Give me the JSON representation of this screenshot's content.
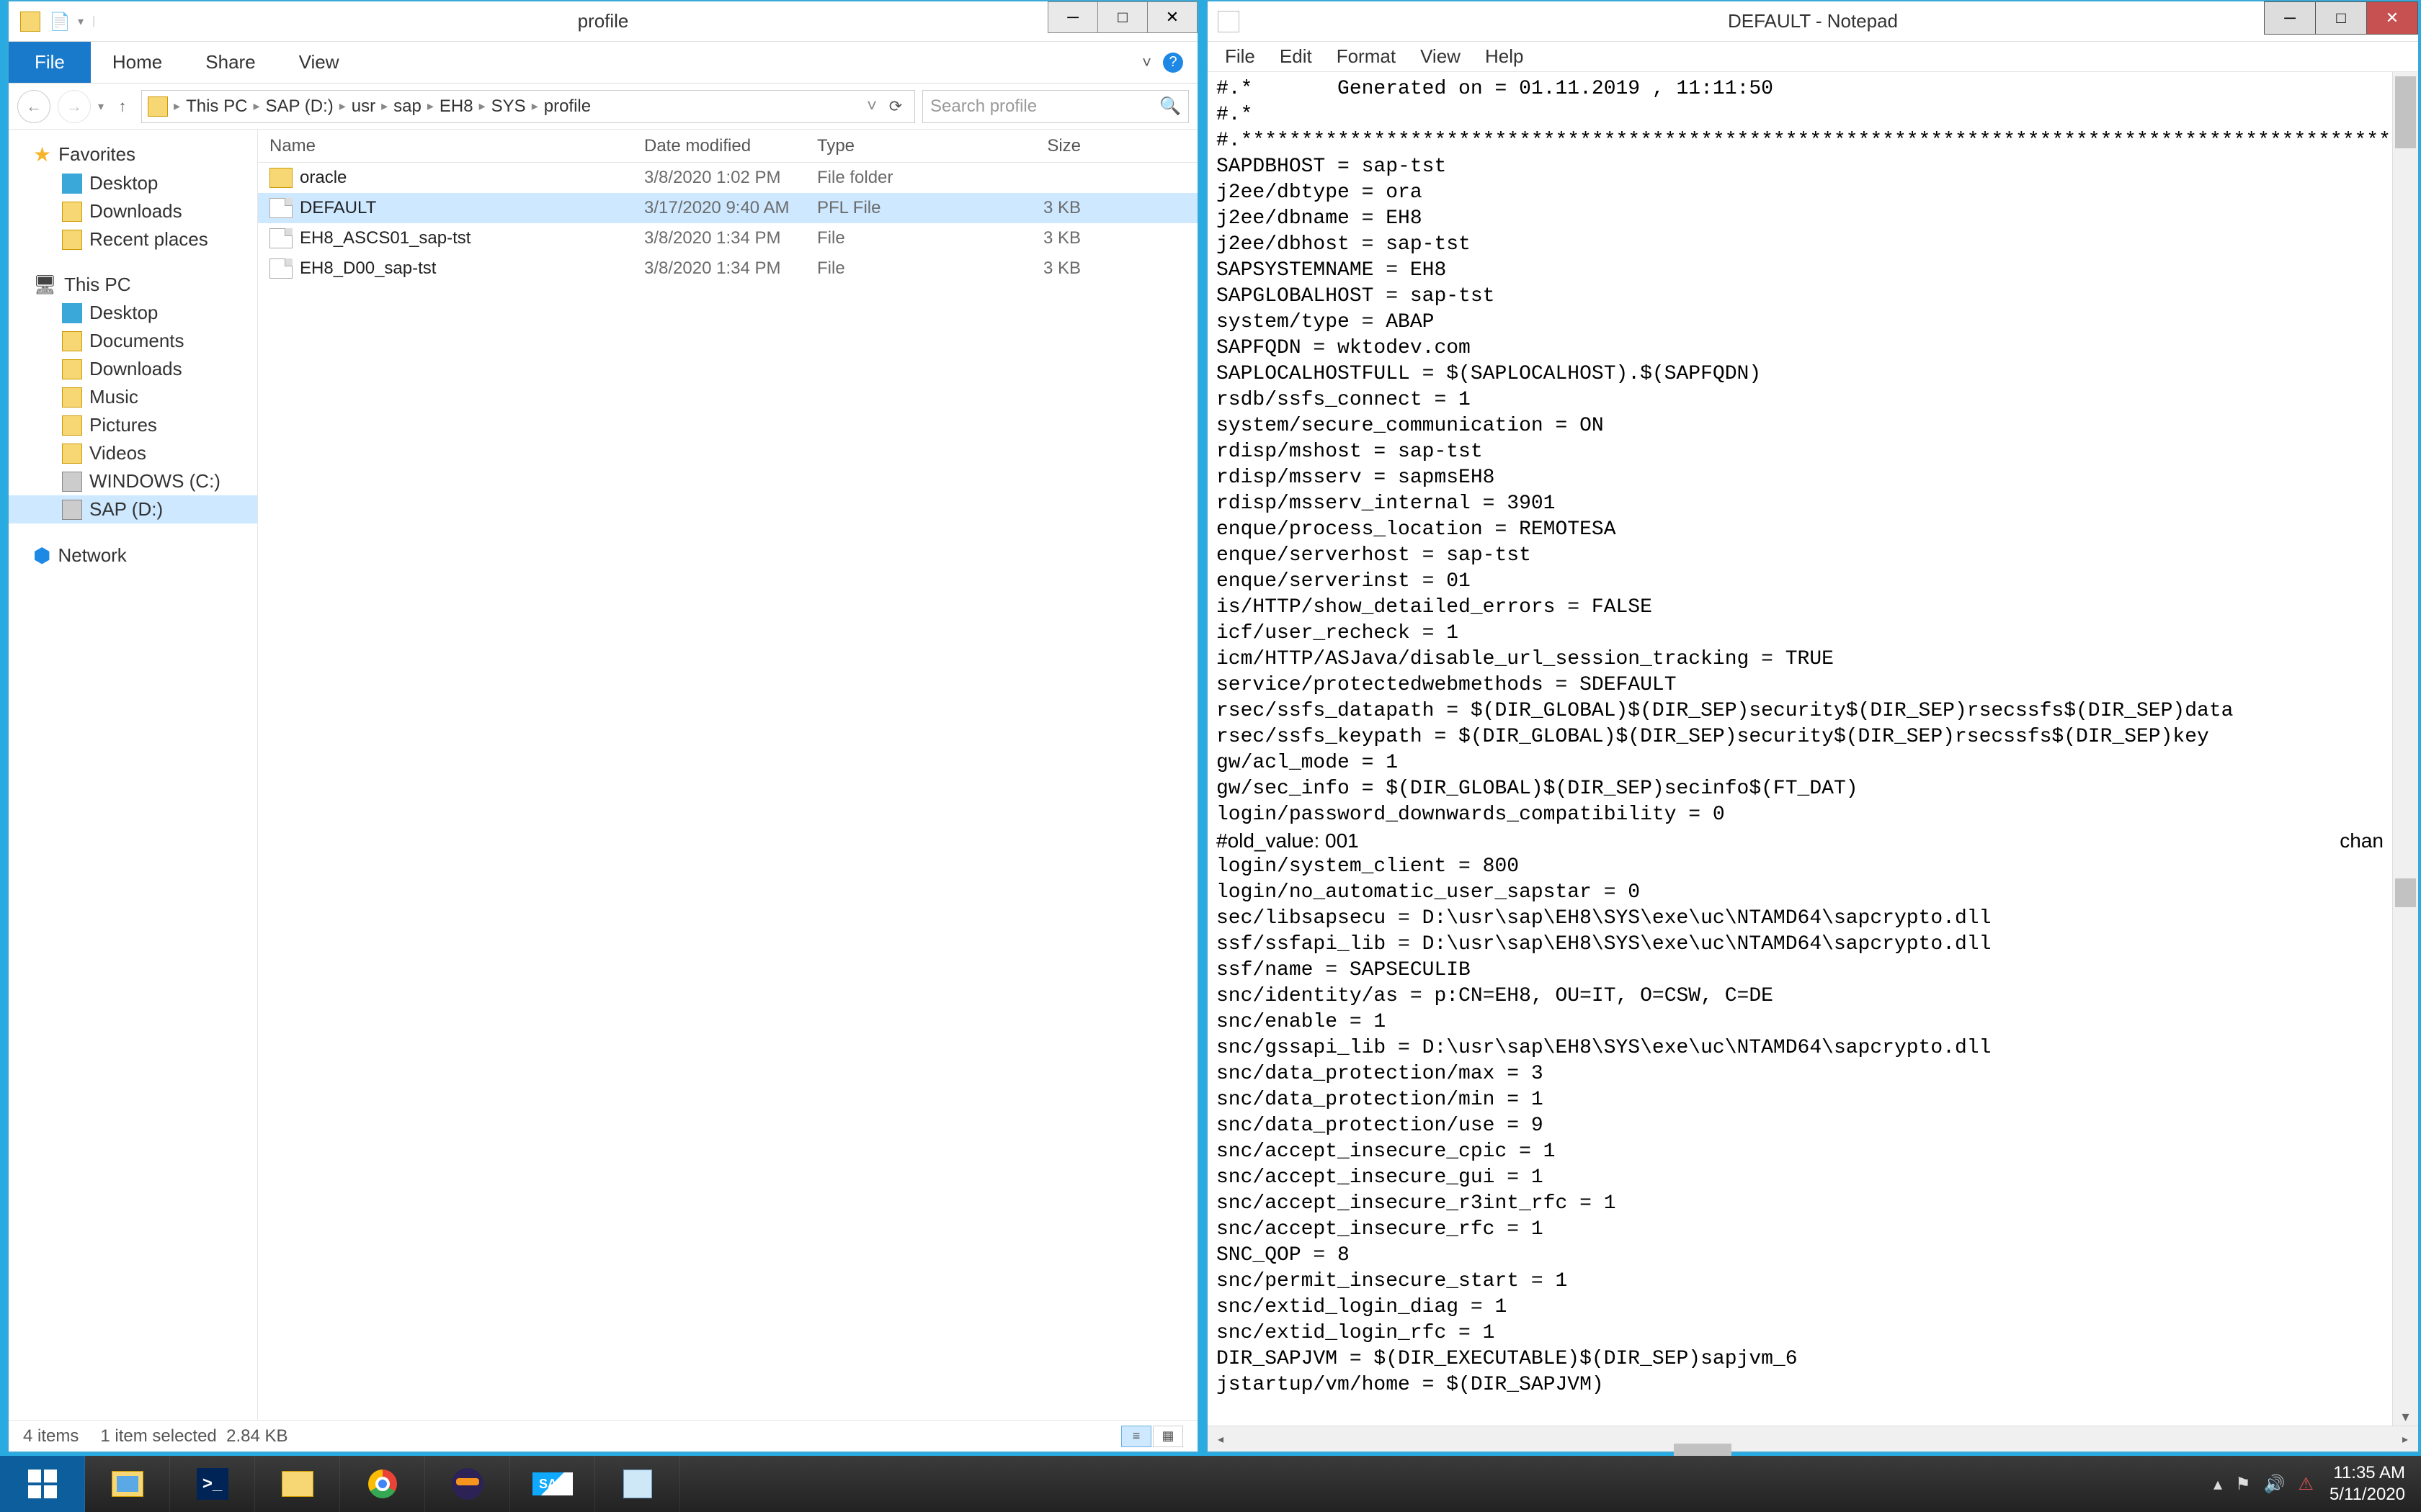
{
  "explorer": {
    "title": "profile",
    "qat_items": [
      "properties-icon",
      "new-folder-icon"
    ],
    "ribbon": {
      "file": "File",
      "tabs": [
        "Home",
        "Share",
        "View"
      ]
    },
    "nav": {
      "breadcrumbs": [
        "This PC",
        "SAP (D:)",
        "usr",
        "sap",
        "EH8",
        "SYS",
        "profile"
      ],
      "search_placeholder": "Search profile"
    },
    "sidebar": {
      "favorites": {
        "label": "Favorites",
        "items": [
          "Desktop",
          "Downloads",
          "Recent places"
        ]
      },
      "thispc": {
        "label": "This PC",
        "items": [
          "Desktop",
          "Documents",
          "Downloads",
          "Music",
          "Pictures",
          "Videos",
          "WINDOWS (C:)",
          "SAP (D:)"
        ]
      },
      "network": {
        "label": "Network"
      }
    },
    "columns": {
      "name": "Name",
      "date": "Date modified",
      "type": "Type",
      "size": "Size"
    },
    "rows": [
      {
        "name": "oracle",
        "date": "3/8/2020 1:02 PM",
        "type": "File folder",
        "size": "",
        "icon": "folder",
        "sel": false
      },
      {
        "name": "DEFAULT",
        "date": "3/17/2020 9:40 AM",
        "type": "PFL File",
        "size": "3 KB",
        "icon": "file",
        "sel": true
      },
      {
        "name": "EH8_ASCS01_sap-tst",
        "date": "3/8/2020 1:34 PM",
        "type": "File",
        "size": "3 KB",
        "icon": "file",
        "sel": false
      },
      {
        "name": "EH8_D00_sap-tst",
        "date": "3/8/2020 1:34 PM",
        "type": "File",
        "size": "3 KB",
        "icon": "file",
        "sel": false
      }
    ],
    "status": {
      "count": "4 items",
      "selection": "1 item selected",
      "size": "2.84 KB"
    }
  },
  "notepad": {
    "title": "DEFAULT - Notepad",
    "menu": [
      "File",
      "Edit",
      "Format",
      "View",
      "Help"
    ],
    "overflow_hint": "chan",
    "content": "#.*       Generated on = 01.11.2019 , 11:11:50\n#.*\n#.**********************************************************************************************************\nSAPDBHOST = sap-tst\nj2ee/dbtype = ora\nj2ee/dbname = EH8\nj2ee/dbhost = sap-tst\nSAPSYSTEMNAME = EH8\nSAPGLOBALHOST = sap-tst\nsystem/type = ABAP\nSAPFQDN = wktodev.com\nSAPLOCALHOSTFULL = $(SAPLOCALHOST).$(SAPFQDN)\nrsdb/ssfs_connect = 1\nsystem/secure_communication = ON\nrdisp/mshost = sap-tst\nrdisp/msserv = sapmsEH8\nrdisp/msserv_internal = 3901\nenque/process_location = REMOTESA\nenque/serverhost = sap-tst\nenque/serverinst = 01\nis/HTTP/show_detailed_errors = FALSE\nicf/user_recheck = 1\nicm/HTTP/ASJava/disable_url_session_tracking = TRUE\nservice/protectedwebmethods = SDEFAULT\nrsec/ssfs_datapath = $(DIR_GLOBAL)$(DIR_SEP)security$(DIR_SEP)rsecssfs$(DIR_SEP)data\nrsec/ssfs_keypath = $(DIR_GLOBAL)$(DIR_SEP)security$(DIR_SEP)rsecssfs$(DIR_SEP)key\ngw/acl_mode = 1\ngw/sec_info = $(DIR_GLOBAL)$(DIR_SEP)secinfo$(FT_DAT)\nlogin/password_downwards_compatibility = 0\n#old_value: 001\nlogin/system_client = 800\nlogin/no_automatic_user_sapstar = 0\nsec/libsapsecu = D:\\usr\\sap\\EH8\\SYS\\exe\\uc\\NTAMD64\\sapcrypto.dll\nssf/ssfapi_lib = D:\\usr\\sap\\EH8\\SYS\\exe\\uc\\NTAMD64\\sapcrypto.dll\nssf/name = SAPSECULIB\nsnc/identity/as = p:CN=EH8, OU=IT, O=CSW, C=DE\nsnc/enable = 1\nsnc/gssapi_lib = D:\\usr\\sap\\EH8\\SYS\\exe\\uc\\NTAMD64\\sapcrypto.dll\nsnc/data_protection/max = 3\nsnc/data_protection/min = 1\nsnc/data_protection/use = 9\nsnc/accept_insecure_cpic = 1\nsnc/accept_insecure_gui = 1\nsnc/accept_insecure_r3int_rfc = 1\nsnc/accept_insecure_rfc = 1\nSNC_QOP = 8\nsnc/permit_insecure_start = 1\nsnc/extid_login_diag = 1\nsnc/extid_login_rfc = 1\nDIR_SAPJVM = $(DIR_EXECUTABLE)$(DIR_SEP)sapjvm_6\njstartup/vm/home = $(DIR_SAPJVM)"
  },
  "taskbar": {
    "time": "11:35 AM",
    "date": "5/11/2020",
    "tray": [
      "chevron-up",
      "flag",
      "speaker",
      "warning"
    ]
  }
}
